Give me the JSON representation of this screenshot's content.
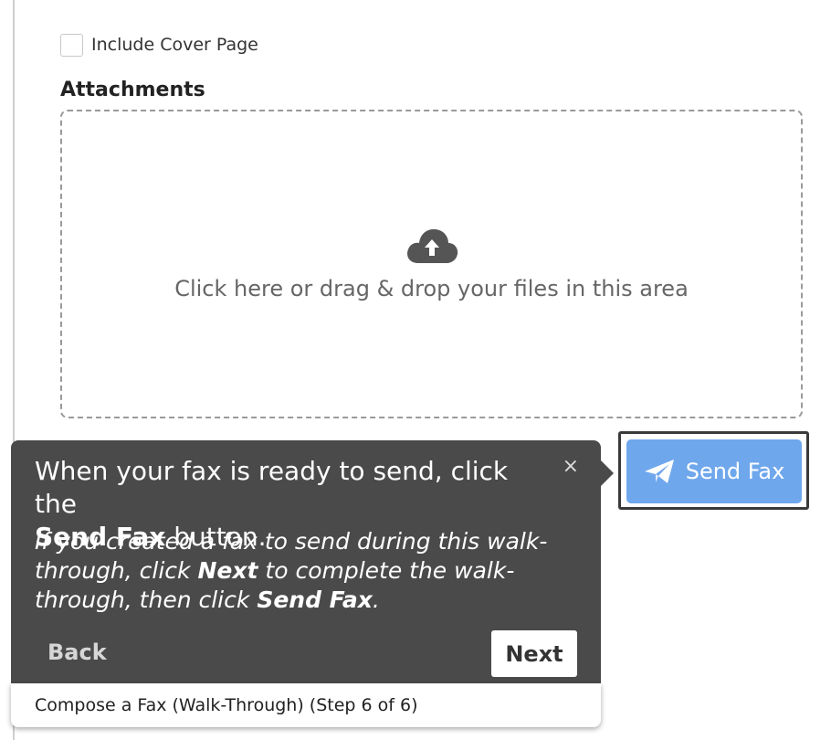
{
  "form": {
    "cover_page_label": "Include Cover Page",
    "cover_page_checked": false,
    "attachments_title": "Attachments",
    "dropzone_text": "Click here or drag & drop your files in this area",
    "dropzone_icon": "cloud-upload-icon"
  },
  "send_button": {
    "label": "Send Fax",
    "icon": "paper-plane-icon",
    "color": "#6fa7ec"
  },
  "tooltip": {
    "line1_plain_a": "When your fax is ready to send, click the",
    "line1_bold": "Send Fax",
    "line1_plain_b": " button.",
    "italic_a": "If you created a fax to send during this walk-through, click ",
    "italic_bold_1": "Next",
    "italic_b": " to complete the walk-through, then click ",
    "italic_bold_2": "Send Fax",
    "italic_c": ".",
    "close_glyph": "×",
    "back_label": "Back",
    "next_label": "Next",
    "footer": "Compose a Fax (Walk-Through) (Step 6 of 6)",
    "background_color": "#4a4a4a"
  }
}
